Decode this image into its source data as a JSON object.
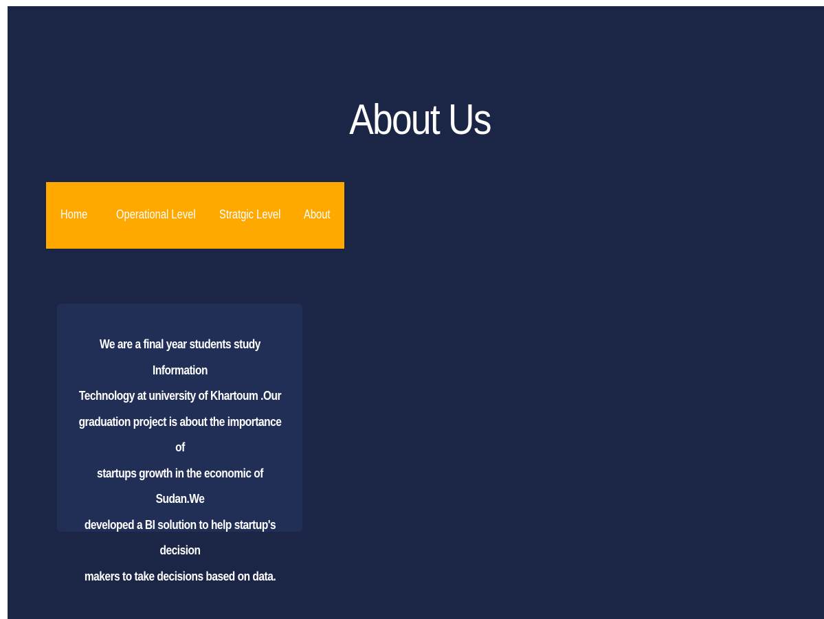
{
  "page": {
    "title": "About Us"
  },
  "nav": {
    "items": [
      {
        "label": "Home"
      },
      {
        "label": "Operational Level"
      },
      {
        "label": "Stratgic Level"
      },
      {
        "label": "About"
      }
    ]
  },
  "about_card": {
    "lines": [
      "We are a final year students study Information",
      "Technology at university of Khartoum .Our",
      "graduation project is about the importance of",
      "startups growth in the economic of Sudan.We",
      "developed a BI solution to help startup's decision",
      "makers to take decisions based on data."
    ]
  },
  "colors": {
    "background": "#1b2545",
    "navbar": "#ffa800",
    "card": "#212e55",
    "text": "#ffffff"
  }
}
